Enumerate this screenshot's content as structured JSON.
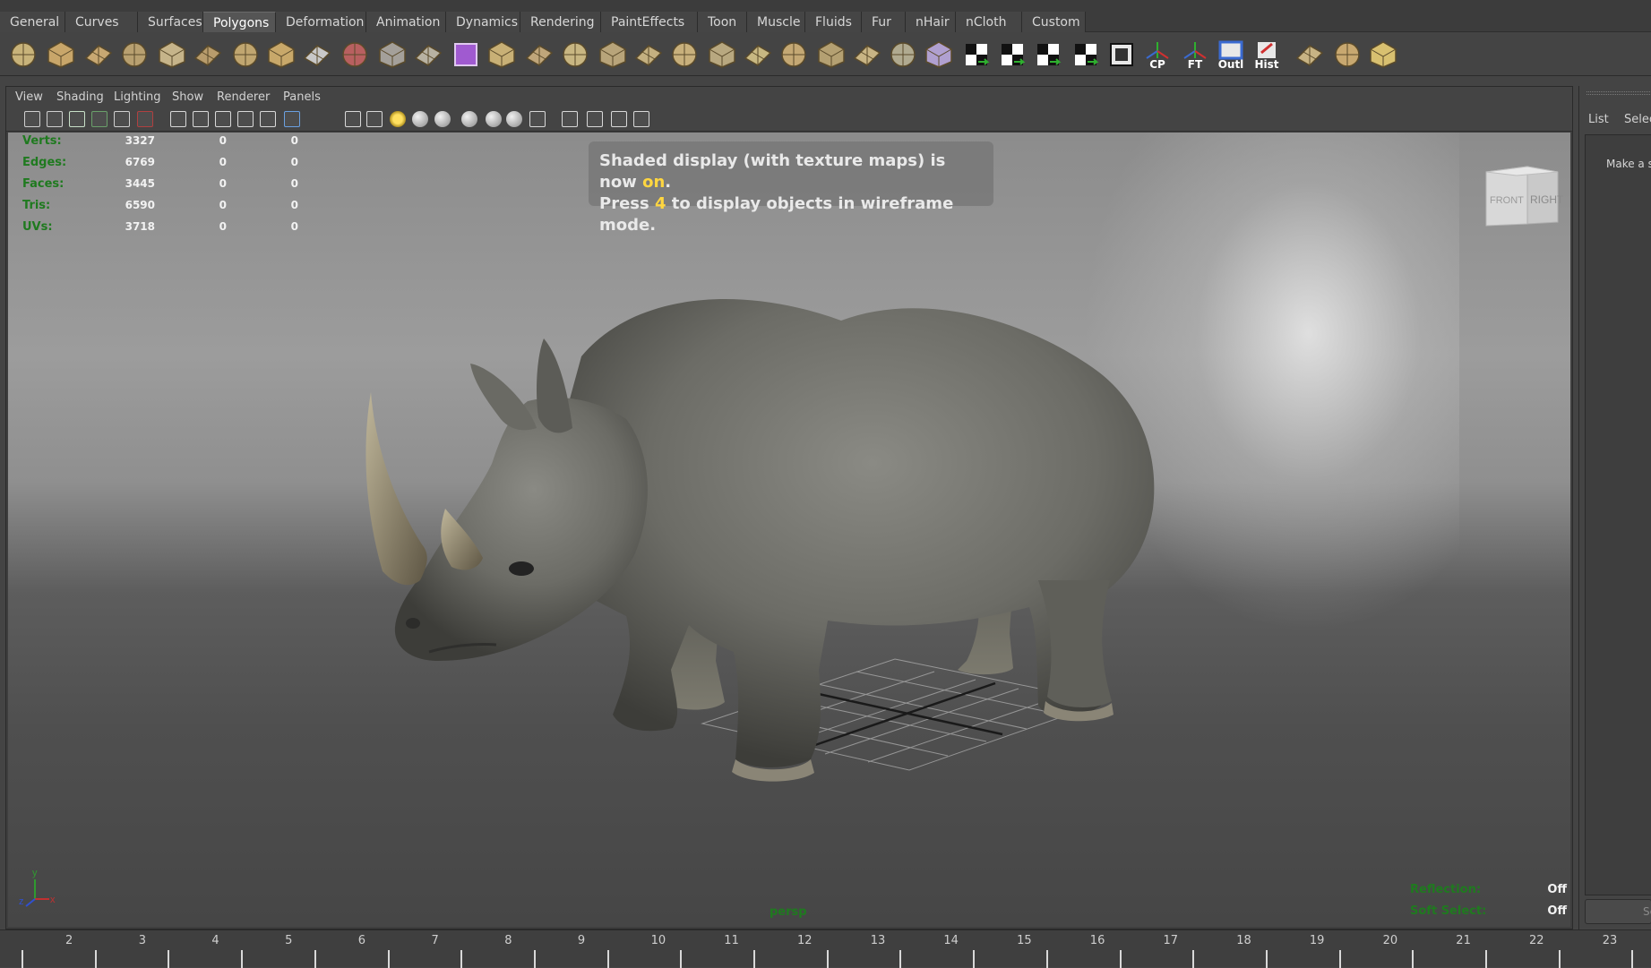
{
  "shelf": {
    "tabs": [
      "General",
      "Curves",
      "Surfaces",
      "Polygons",
      "Deformation",
      "Animation",
      "Dynamics",
      "Rendering",
      "PaintEffects",
      "Toon",
      "Muscle",
      "Fluids",
      "Fur",
      "nHair",
      "nCloth",
      "Custom"
    ],
    "active_tab": "Polygons",
    "icon_labels": {
      "cp": "CP",
      "ft": "FT",
      "outl": "Outl",
      "hist": "Hist"
    }
  },
  "panel_menu": [
    "View",
    "Shading",
    "Lighting",
    "Show",
    "Renderer",
    "Panels"
  ],
  "hud": {
    "rows": [
      {
        "label": "Verts:",
        "values": [
          "3327",
          "0",
          "0"
        ]
      },
      {
        "label": "Edges:",
        "values": [
          "6769",
          "0",
          "0"
        ]
      },
      {
        "label": "Faces:",
        "values": [
          "3445",
          "0",
          "0"
        ]
      },
      {
        "label": "Tris:",
        "values": [
          "6590",
          "0",
          "0"
        ]
      },
      {
        "label": "UVs:",
        "values": [
          "3718",
          "0",
          "0"
        ]
      }
    ],
    "reflection_label": "Reflection:",
    "reflection_value": "Off",
    "soft_select_label": "Soft Select:",
    "soft_select_value": "Off"
  },
  "notice": {
    "line1_prefix": "Shaded display (with texture maps) is now ",
    "line1_highlight": "on",
    "line1_suffix": ".",
    "line2_prefix": "Press ",
    "line2_highlight": "4",
    "line2_suffix": " to display objects in wireframe mode."
  },
  "view_cube": {
    "front": "FRONT",
    "right": "RIGHT"
  },
  "camera_label": "persp",
  "axis": {
    "y": "y",
    "z": "z",
    "x": "x"
  },
  "side_panel": {
    "menu": [
      "List",
      "Selec"
    ],
    "message": "Make a s",
    "button": "Se"
  },
  "timeline": {
    "frames": [
      "2",
      "3",
      "4",
      "5",
      "6",
      "7",
      "8",
      "9",
      "10",
      "11",
      "12",
      "13",
      "14",
      "15",
      "16",
      "17",
      "18",
      "19",
      "20",
      "21",
      "22",
      "23"
    ]
  },
  "colors": {
    "hud_green": "#1f7a1f",
    "highlight": "#ffd640",
    "active_tab": "#555555"
  }
}
